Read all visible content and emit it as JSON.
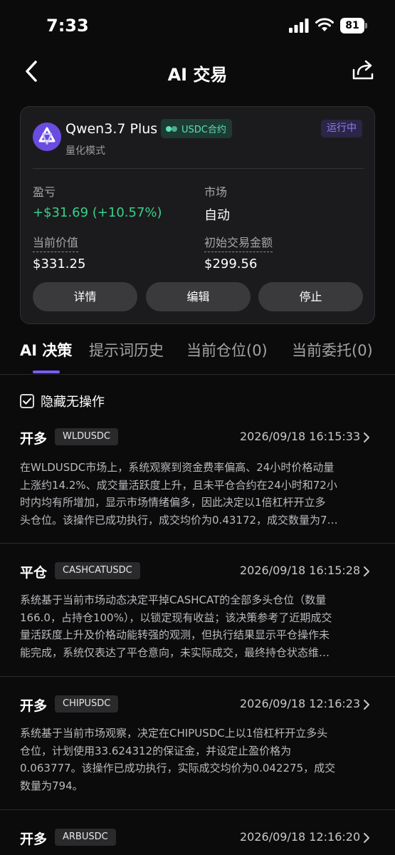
{
  "status_bar": {
    "time": "7:33",
    "battery": "81"
  },
  "header": {
    "title": "AI 交易"
  },
  "bot": {
    "name": "Qwen3.7 Plus",
    "contract": "USDC合约",
    "status": "运行中",
    "mode": "量化模式",
    "pnl_label": "盈亏",
    "pnl_value": "+$31.69 (+10.57%)",
    "market_label": "市场",
    "market_value": "自动",
    "current_value_label": "当前价值",
    "current_value": "$331.25",
    "initial_label": "初始交易金额",
    "initial_value": "$299.56",
    "buttons": {
      "details": "详情",
      "edit": "编辑",
      "stop": "停止"
    }
  },
  "tabs": [
    "AI 决策",
    "提示词历史",
    "当前仓位(0)",
    "当前委托(0)"
  ],
  "hide_no_action": "隐藏无操作",
  "decisions": [
    {
      "action": "开多",
      "symbol": "WLDUSDC",
      "time": "2026/09/18 16:15:33",
      "lines": [
        "在WLDUSDC市场上，系统观察到资金费率偏高、24小时价格动量",
        "上涨约14.2%、成交量活跃度上升，且未平仓合约在24小时和72小",
        "时内均有所增加，显示市场情绪偏多，因此决定以1倍杠杆开立多",
        "头仓位。该操作已成功执行，成交均价为0.43172，成交数量为7…"
      ]
    },
    {
      "action": "平仓",
      "symbol": "CASHCATUSDC",
      "time": "2026/09/18 16:15:28",
      "lines": [
        "系统基于当前市场动态决定平掉CASHCAT的全部多头仓位（数量",
        "166.0，占持仓100%），以锁定现有收益；该决策参考了近期成交",
        "量活跃度上升及价格动能转强的观测，但执行结果显示平仓操作未",
        "能完成，系统仅表达了平仓意向，未实际成交，最终持仓状态维…"
      ]
    },
    {
      "action": "开多",
      "symbol": "CHIPUSDC",
      "time": "2026/09/18 12:16:23",
      "lines": [
        "系统基于当前市场观察，决定在CHIPUSDC上以1倍杠杆开立多头",
        "仓位，计划使用33.624312的保证金，并设定止盈价格为",
        "0.063777。该操作已成功执行，实际成交均价为0.042275，成交",
        "数量为794。"
      ]
    },
    {
      "action": "开多",
      "symbol": "ARBUSDC",
      "time": "2026/09/18 12:16:20",
      "lines": []
    }
  ]
}
